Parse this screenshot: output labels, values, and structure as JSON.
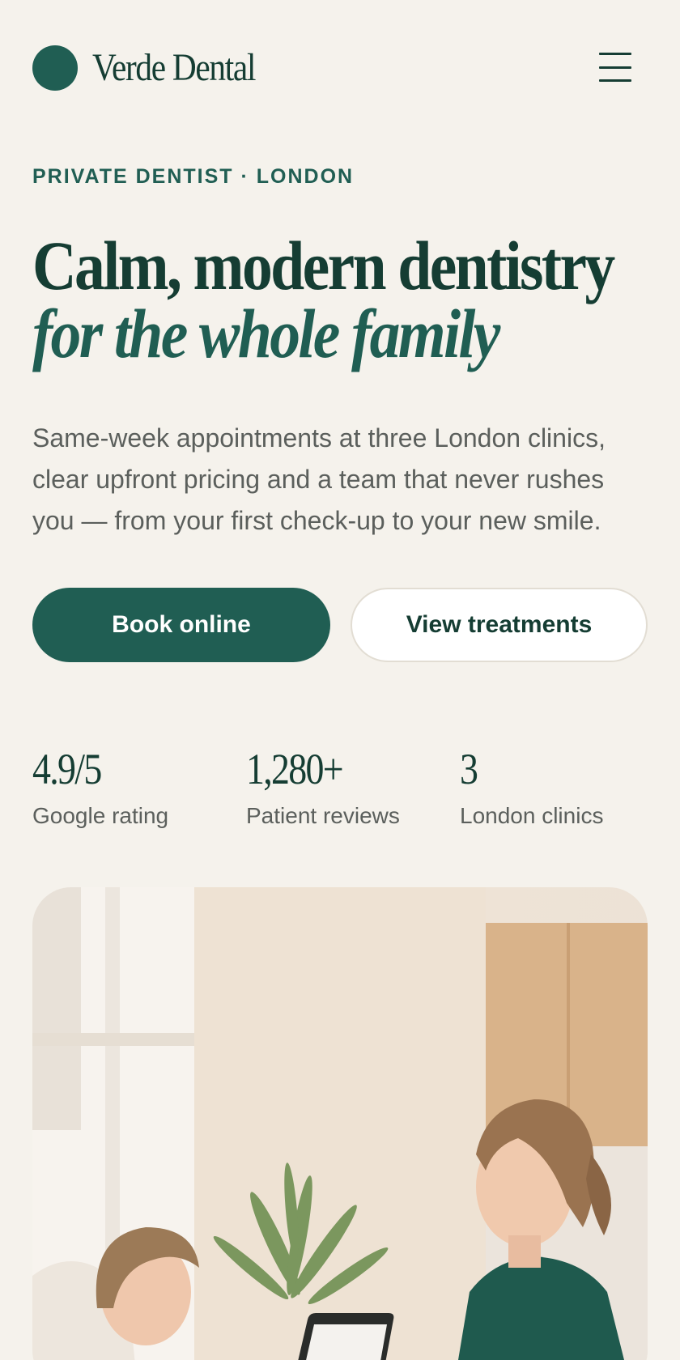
{
  "header": {
    "brand": "Verde Dental",
    "menu_icon": "hamburger-menu-icon"
  },
  "hero": {
    "eyebrow": "PRIVATE DENTIST · LONDON",
    "headline_plain": "Calm, modern dentistry ",
    "headline_italic": "for the whole family",
    "lead": "Same-week appointments at three London clinics, clear upfront pricing and a team that never rushes you — from your first check-up to your new smile.",
    "primary_cta": "Book online",
    "secondary_cta": "View treatments"
  },
  "stats": [
    {
      "value": "4.9/5",
      "label": "Google rating"
    },
    {
      "value": "1,280+",
      "label": "Patient reviews"
    },
    {
      "value": "3",
      "label": "London clinics"
    }
  ],
  "colors": {
    "background": "#f5f2ec",
    "brand_green": "#205e53",
    "ink": "#153d33",
    "muted_text": "#5b5f5c"
  }
}
